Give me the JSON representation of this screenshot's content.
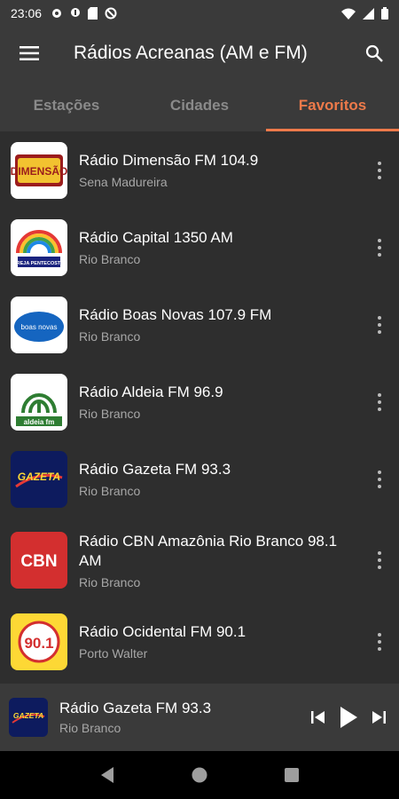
{
  "status": {
    "time": "23:06",
    "icons_left": [
      "gear-icon",
      "mic-icon",
      "sd-card-icon",
      "no-sign-icon"
    ],
    "icons_right": [
      "wifi-icon",
      "signal-icon",
      "battery-icon"
    ]
  },
  "app_bar": {
    "title": "Rádios Acreanas (AM e FM)",
    "menu_icon": "hamburger-menu-icon",
    "search_icon": "search-icon"
  },
  "tabs": [
    {
      "label": "Estações",
      "active": false
    },
    {
      "label": "Cidades",
      "active": false
    },
    {
      "label": "Favoritos",
      "active": true
    }
  ],
  "colors": {
    "accent": "#ee7a4a",
    "background": "#2e2e2e",
    "bar": "#3a3a3a"
  },
  "stations": [
    {
      "name": "Rádio Dimensão FM 104.9",
      "city": "Sena Madureira",
      "logo": "DIMENSÃO"
    },
    {
      "name": "Rádio Capital 1350 AM",
      "city": "Rio Branco",
      "logo": "IGREJA PENTECOSTAL"
    },
    {
      "name": "Rádio Boas Novas 107.9 FM",
      "city": "Rio Branco",
      "logo": "boas novas"
    },
    {
      "name": "Rádio Aldeia FM 96.9",
      "city": "Rio Branco",
      "logo": "aldeia fm"
    },
    {
      "name": "Rádio Gazeta FM 93.3",
      "city": "Rio Branco",
      "logo": "GAZETA"
    },
    {
      "name": "Rádio CBN Amazônia Rio Branco 98.1 AM",
      "city": "Rio Branco",
      "logo": "CBN"
    },
    {
      "name": "Rádio Ocidental FM 90.1",
      "city": "Porto Walter",
      "logo": "90.1"
    }
  ],
  "player": {
    "title": "Rádio Gazeta FM 93.3",
    "subtitle": "Rio Branco",
    "logo": "GAZETA",
    "controls": [
      "skip-previous-icon",
      "play-icon",
      "skip-next-icon"
    ]
  },
  "nav": [
    "back-icon",
    "home-icon",
    "recents-icon"
  ]
}
